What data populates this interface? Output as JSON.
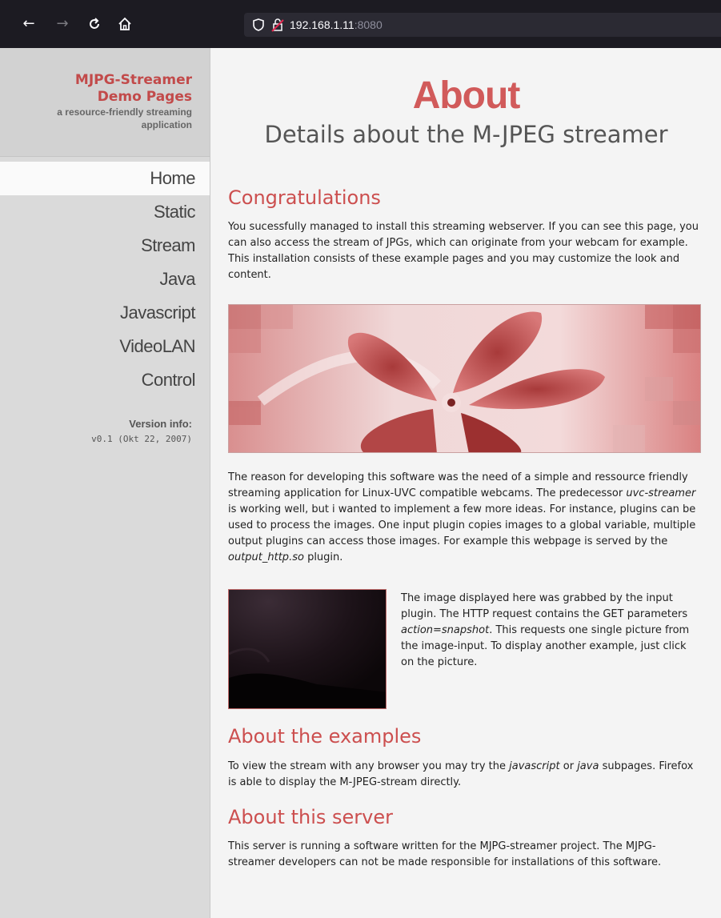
{
  "browser": {
    "url_host": "192.168.1.11",
    "url_port": ":8080",
    "icons": [
      "back-icon",
      "forward-icon",
      "reload-icon",
      "home-icon",
      "shield-icon",
      "insecure-lock-icon"
    ]
  },
  "sidebar": {
    "brand_title_line1": "MJPG-Streamer",
    "brand_title_line2": "Demo Pages",
    "brand_sub_line1": "a resource-friendly streaming",
    "brand_sub_line2": "application",
    "menu": [
      {
        "label": "Home",
        "active": true
      },
      {
        "label": "Static"
      },
      {
        "label": "Stream"
      },
      {
        "label": "Java"
      },
      {
        "label": "Javascript"
      },
      {
        "label": "VideoLAN"
      },
      {
        "label": "Control"
      }
    ],
    "version_label": "Version info:",
    "version_value": "v0.1 (Okt 22, 2007)"
  },
  "main": {
    "title": "About",
    "subtitle": "Details about the M-JPEG streamer",
    "congrats_heading": "Congratulations",
    "congrats_text": "You sucessfully managed to install this streaming webserver. If you can see this page, you can also access the stream of JPGs, which can originate from your webcam for example. This installation consists of these example pages and you may customize the look and content.",
    "reason_1": "The reason for developing this software was the need of a simple and ressource friendly streaming application for Linux-UVC compatible webcams. The predecessor ",
    "reason_em1": "uvc-streamer",
    "reason_2": " is working well, but i wanted to implement a few more ideas. For instance, plugins can be used to process the images. One input plugin copies images to a global variable, multiple output plugins can access those images. For example this webpage is served by the ",
    "reason_em2": "output_http.so",
    "reason_3": " plugin.",
    "snapshot_1": "The image displayed here was grabbed by the input plugin. The HTTP request contains the GET parameters ",
    "snapshot_em": "action=snapshot",
    "snapshot_2": ". This requests one single picture from the image-input. To display another example, just click on the picture.",
    "examples_heading": "About the examples",
    "examples_1": "To view the stream with any browser you may try the ",
    "examples_em1": "javascript",
    "examples_2": " or ",
    "examples_em2": "java",
    "examples_3": " subpages. Firefox is able to display the M-JPEG-stream directly.",
    "server_heading": "About this server",
    "server_text": "This server is running a software written for the MJPG-streamer project. The MJPG-streamer developers can not be made responsible for installations of this software."
  },
  "colors": {
    "accent": "#cc4f4f",
    "sidebar_bg": "#dadada",
    "page_bg": "#f4f4f4",
    "toolbar_bg": "#1c1b22"
  }
}
